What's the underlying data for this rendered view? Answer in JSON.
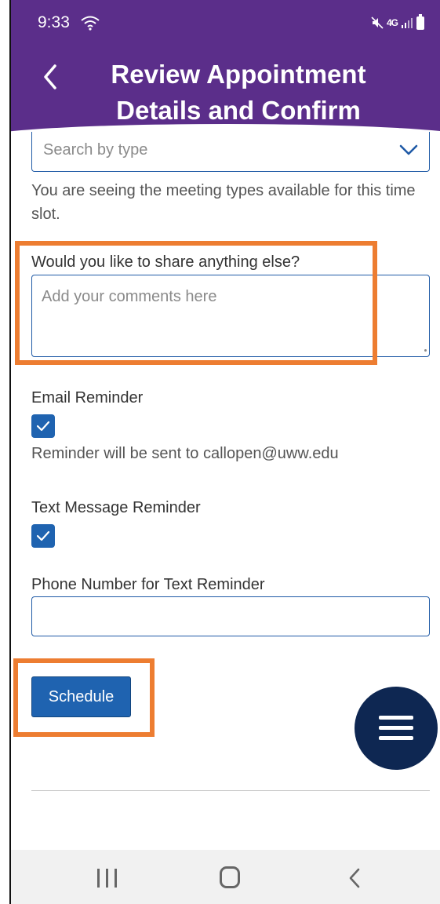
{
  "status_bar": {
    "time": "9:33",
    "network": "4G",
    "icons": [
      "wifi-icon",
      "mute-icon",
      "signal-icon",
      "battery-icon"
    ]
  },
  "header": {
    "title_line1": "Review Appointment",
    "title_line2": "Details and Confirm",
    "back_icon": "chevron-left-icon"
  },
  "form": {
    "meeting_type": {
      "placeholder": "Search by type",
      "helper": "You are seeing the meeting types available for this time slot."
    },
    "comments": {
      "label": "Would you like to share anything else?",
      "placeholder": "Add your comments here"
    },
    "email_reminder": {
      "label": "Email Reminder",
      "checked": true,
      "note": "Reminder will be sent to callopen@uww.edu"
    },
    "text_reminder": {
      "label": "Text Message Reminder",
      "checked": true
    },
    "phone": {
      "label": "Phone Number for Text Reminder",
      "value": ""
    },
    "schedule_label": "Schedule"
  },
  "colors": {
    "header_bg": "#5b2e8a",
    "primary": "#1f63b0",
    "highlight": "#ed7d31",
    "fab_bg": "#0e2752"
  },
  "fab_icon": "menu-icon",
  "nav_icons": [
    "recents-icon",
    "home-icon",
    "back-icon"
  ]
}
